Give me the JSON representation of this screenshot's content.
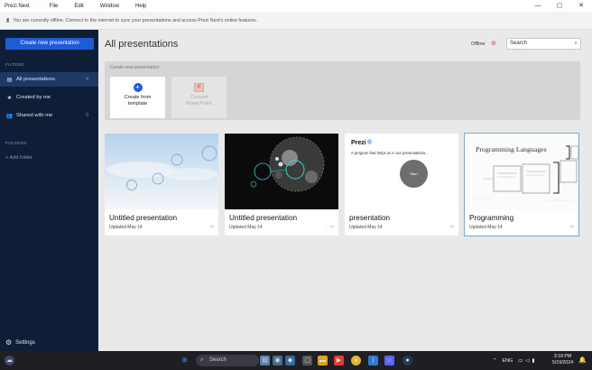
{
  "window": {
    "app_title": "Prezi Next",
    "menu": [
      "File",
      "Edit",
      "Window",
      "Help"
    ],
    "controls": [
      "—",
      "▢",
      "✕"
    ]
  },
  "offline_bar": {
    "message": "You are currently offline. Connect to the internet to sync your presentations and access Prezi Next's online features."
  },
  "sidebar": {
    "create_button": "Create new presentation",
    "filters_label": "FILTERS",
    "items": [
      {
        "label": "All presentations",
        "count": "4",
        "icon": "▤"
      },
      {
        "label": "Created by me",
        "count": "",
        "icon": "★"
      },
      {
        "label": "Shared with me",
        "count": "0",
        "icon": "👥"
      }
    ],
    "folders_label": "FOLDERS",
    "add_folder": "+   Add folder",
    "settings": "Settings"
  },
  "main": {
    "title": "All presentations",
    "status": "Offline",
    "search_placeholder": "Search",
    "new_panel": {
      "header": "Create new presentation",
      "tiles": [
        {
          "label": "Create from template",
          "icon": "plus-icon"
        },
        {
          "label": "Convert PowerPoint",
          "icon": "powerpoint-icon"
        }
      ]
    },
    "presentations": [
      {
        "title": "Untitled presentation",
        "updated": "Updated May 14"
      },
      {
        "title": "Untitled presentation",
        "updated": "Updated May 14"
      },
      {
        "title": "presentation",
        "updated": "Updated May 14",
        "thumb_heading": "Prezi",
        "thumb_text": "A program that helps us in our presentations...",
        "thumb_circle": "Start"
      },
      {
        "title": "Programming",
        "updated": "Updated May 14",
        "thumb_heading": "Programming Languages"
      }
    ]
  },
  "taskbar": {
    "search": "Search",
    "lang": "ENG",
    "time": "3:18 PM",
    "date": "5/19/2024"
  },
  "colors": {
    "sidebar_bg": "#0e1e36",
    "accent": "#1f5bd6",
    "active_item": "#1d3a64"
  }
}
